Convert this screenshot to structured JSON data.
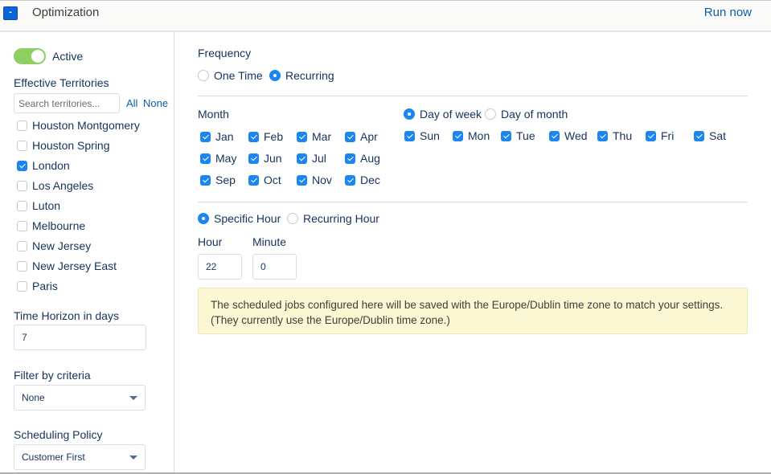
{
  "header": {
    "collapse_icon": "-",
    "title": "Optimization",
    "run_now_label": "Run now"
  },
  "sidebar": {
    "active_label": "Active",
    "active_on": true,
    "territories_label": "Effective Territories",
    "search_placeholder": "Search territories...",
    "all_label": "All",
    "none_label": "None",
    "territories": [
      {
        "name": "Houston Montgomery",
        "checked": false
      },
      {
        "name": "Houston Spring",
        "checked": false
      },
      {
        "name": "London",
        "checked": true
      },
      {
        "name": "Los Angeles",
        "checked": false
      },
      {
        "name": "Luton",
        "checked": false
      },
      {
        "name": "Melbourne",
        "checked": false
      },
      {
        "name": "New Jersey",
        "checked": false
      },
      {
        "name": "New Jersey East",
        "checked": false
      },
      {
        "name": "Paris",
        "checked": false
      }
    ],
    "time_horizon_label": "Time Horizon in days",
    "time_horizon_value": "7",
    "filter_label": "Filter by criteria",
    "filter_value": "None",
    "policy_label": "Scheduling Policy",
    "policy_value": "Customer First"
  },
  "main": {
    "frequency_label": "Frequency",
    "frequency_options": [
      {
        "label": "One Time",
        "checked": false
      },
      {
        "label": "Recurring",
        "checked": true
      }
    ],
    "month_label": "Month",
    "months": [
      {
        "label": "Jan",
        "checked": true
      },
      {
        "label": "Feb",
        "checked": true
      },
      {
        "label": "Mar",
        "checked": true
      },
      {
        "label": "Apr",
        "checked": true
      },
      {
        "label": "May",
        "checked": true
      },
      {
        "label": "Jun",
        "checked": true
      },
      {
        "label": "Jul",
        "checked": true
      },
      {
        "label": "Aug",
        "checked": true
      },
      {
        "label": "Sep",
        "checked": true
      },
      {
        "label": "Oct",
        "checked": true
      },
      {
        "label": "Nov",
        "checked": true
      },
      {
        "label": "Dec",
        "checked": true
      }
    ],
    "day_mode_options": [
      {
        "label": "Day of week",
        "checked": true
      },
      {
        "label": "Day of month",
        "checked": false
      }
    ],
    "days": [
      {
        "label": "Sun",
        "checked": true
      },
      {
        "label": "Mon",
        "checked": true
      },
      {
        "label": "Tue",
        "checked": true
      },
      {
        "label": "Wed",
        "checked": true
      },
      {
        "label": "Thu",
        "checked": true
      },
      {
        "label": "Fri",
        "checked": true
      },
      {
        "label": "Sat",
        "checked": true
      }
    ],
    "hour_mode_options": [
      {
        "label": "Specific Hour",
        "checked": true
      },
      {
        "label": "Recurring Hour",
        "checked": false
      }
    ],
    "hour_label": "Hour",
    "hour_value": "22",
    "minute_label": "Minute",
    "minute_value": "0",
    "notice": "The scheduled jobs configured here will be saved with the Europe/Dublin time zone to match your settings. (They currently use the Europe/Dublin time zone.)"
  },
  "colors": {
    "accent": "#1b85f0",
    "link": "#0b5cab",
    "toggle_on": "#8ecf63",
    "notice_bg": "#fcf7d3"
  }
}
